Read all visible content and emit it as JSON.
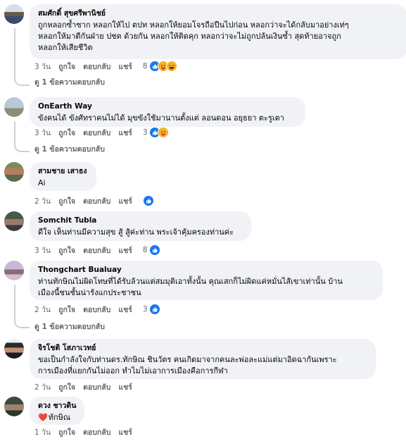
{
  "actions": {
    "like": "ถูกใจ",
    "reply": "ตอบกลับ",
    "share": "แชร์"
  },
  "colors": {
    "like_blue": "#1877f2",
    "bubble": "#f0f2f5",
    "meta": "#65676b"
  },
  "comments": [
    {
      "author": "สมศักดิ์ สุขศรีพานิชย์",
      "text": "ถูกหลอกซ้ำซาก หลอกให้ไป ตปท หลอกให้ยอมโจรถือปืนไปก่อน หลอกว่าจะได้กลับมาอย่างเท่ๆ\nหลอกให้มาตีกันฝ่าย ปชต ด้วยกัน หลอกให้ติดคุก หลอกว่าจะไม่ถูกปล้นเงินซ้ำ สุดท้ายอาจถูก\nหลอกให้เสียชีวิต",
      "time": "3 วัน",
      "reaction_count": "8",
      "reaction_icons": [
        "like-icon",
        "care-icon",
        "haha-icon"
      ],
      "replies": "ดู 1 ข้อความตอบกลับ"
    },
    {
      "author": "OnEarth Way",
      "text": "ขังคนได้ ขังศัทราคนไม่ได้ มุขขังใช้มานานตั้งแต่ ลอนดอน อยุธยา ตะรูเตา",
      "time": "3 วัน",
      "reaction_count": "3",
      "reaction_icons": [
        "like-icon",
        "care-icon"
      ],
      "replies": "ดู 1 ข้อความตอบกลับ"
    },
    {
      "author": "สามชาย เสาธง",
      "text": "Ai",
      "time": "2 วัน",
      "reaction_count": "",
      "reaction_icons": [
        "like-icon"
      ],
      "replies": ""
    },
    {
      "author": "Somchit Tubla",
      "text": "ดีใจ เห็นท่านมีความสุข สู้ สู้ค่ะท่าน พระเจ้าคุ้มครองท่านค่ะ",
      "time": "3 วัน",
      "reaction_count": "8",
      "reaction_icons": [
        "like-icon"
      ],
      "replies": ""
    },
    {
      "author": "Thongchart Bualuay",
      "text": "ท่านทักษิณไม่ผิดโทษที่ได้รับล้วนแต่สมมุติเอาทั้งนั้น คุณเสกก็ไม่ผิดแค่หมั่นไส้เขาเท่านั้น บ้าน\nเมืองนี้ชนชั้นน่ารังแกประชาชน",
      "time": "2 วัน",
      "reaction_count": "3",
      "reaction_icons": [
        "like-icon"
      ],
      "replies": "ดู 1 ข้อความตอบกลับ"
    },
    {
      "author": "จิรโชติ โสภาเวทย์",
      "text": "ขอเป็นกำลังใจกับท่านดร.ทักษิณ ชินวัตร คนเกิดมาจากคนละพ่อละแม่แต่มาอิดฉากันเพราะ\nการเมืองที่แยกกันไม่ออก ทำไมไม่เอาการเมืองคือการกีฬา",
      "time": "2 วัน",
      "reaction_count": "",
      "reaction_icons": [],
      "replies": ""
    },
    {
      "author": "ดวง ชาวดิน",
      "text": "ทักษิณ",
      "heart": "❤️",
      "time": "1 วัน",
      "reaction_count": "",
      "reaction_icons": [],
      "replies": ""
    }
  ]
}
